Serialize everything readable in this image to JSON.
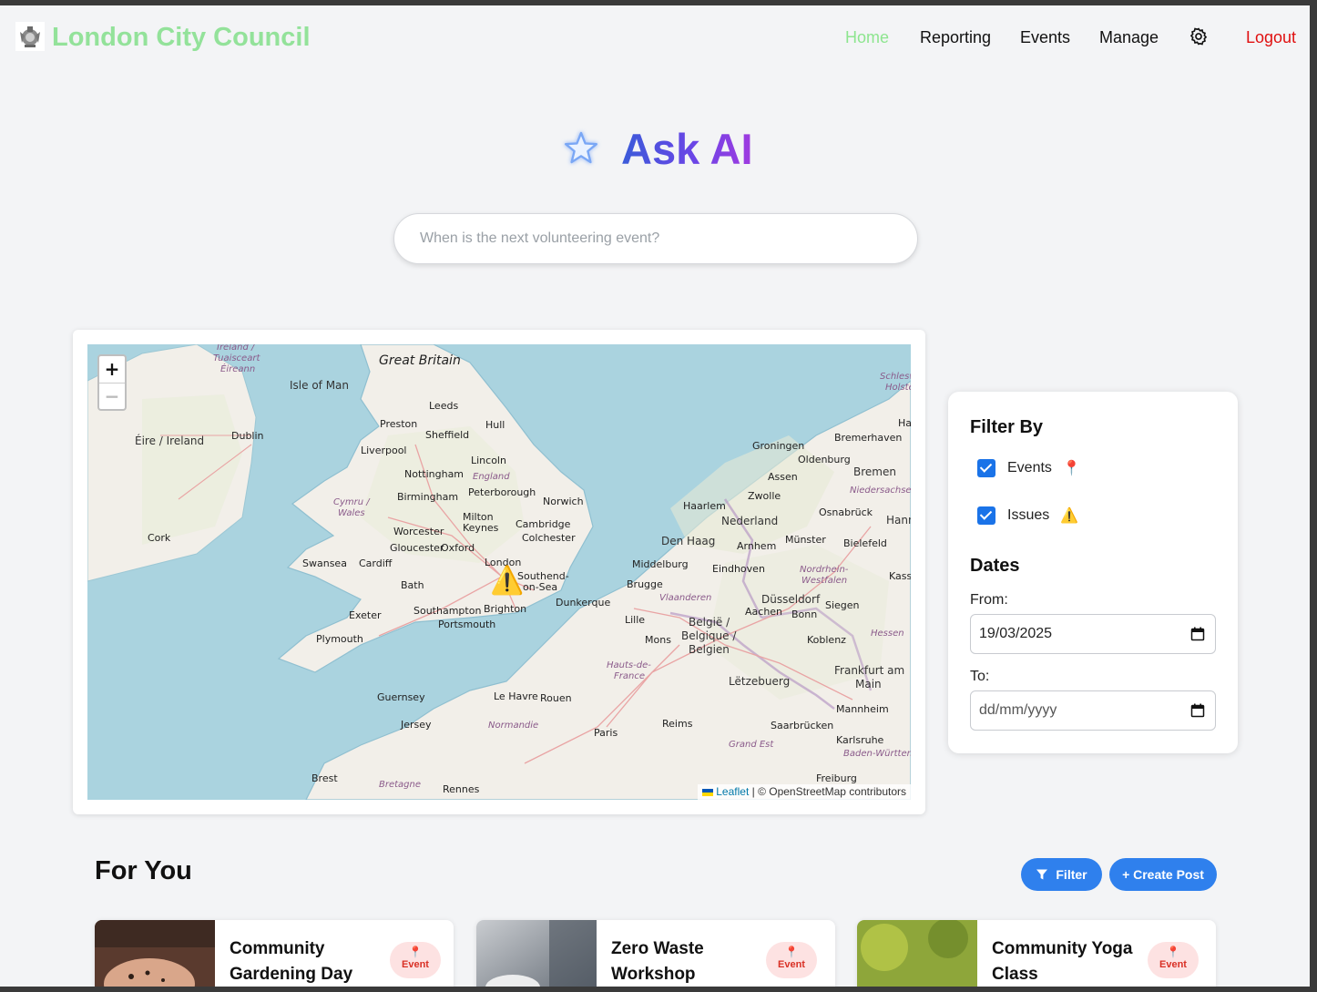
{
  "nav": {
    "brand": "London City Council",
    "links": {
      "home": "Home",
      "reporting": "Reporting",
      "events": "Events",
      "manage": "Manage"
    },
    "logout": "Logout"
  },
  "hero": {
    "title": "Ask AI",
    "search_placeholder": "When is the next volunteering event?"
  },
  "map": {
    "zoom_in": "+",
    "zoom_out": "−",
    "attribution_leaflet": "Leaflet",
    "attribution_rest": "| © OpenStreetMap contributors",
    "places": {
      "great_britain": "Great Britain",
      "ireland_ga": "Ireland /",
      "ireland_tuaisceart": "Tuaisceart",
      "ireland_eireann": "Éireann",
      "isle_of_man": "Isle of Man",
      "eire": "Éire / Ireland",
      "dublin": "Dublin",
      "cork": "Cork",
      "leeds": "Leeds",
      "preston": "Preston",
      "hull": "Hull",
      "sheffield": "Sheffield",
      "liverpool": "Liverpool",
      "lincoln": "Lincoln",
      "nottingham": "Nottingham",
      "england": "England",
      "birmingham": "Birmingham",
      "peterborough": "Peterborough",
      "norwich": "Norwich",
      "cymru": "Cymru /",
      "wales": "Wales",
      "milton_keynes_1": "Milton",
      "milton_keynes_2": "Keynes",
      "cambridge": "Cambridge",
      "worcester": "Worcester",
      "colchester": "Colchester",
      "gloucester": "Gloucester",
      "oxford": "Oxford",
      "london": "London",
      "swansea": "Swansea",
      "cardiff": "Cardiff",
      "southend_1": "Southend-",
      "southend_2": "on-Sea",
      "bath": "Bath",
      "southampton": "Southampton",
      "brighton": "Brighton",
      "exeter": "Exeter",
      "portsmouth": "Portsmouth",
      "plymouth": "Plymouth",
      "guernsey": "Guernsey",
      "jersey": "Jersey",
      "brest": "Brest",
      "bretagne": "Bretagne",
      "rennes": "Rennes",
      "normandie": "Normandie",
      "le_havre": "Le Havre",
      "rouen": "Rouen",
      "paris": "Paris",
      "reims": "Reims",
      "lille": "Lille",
      "dunkerque": "Dunkerque",
      "brugge": "Brugge",
      "middelburg": "Middelburg",
      "den_haag": "Den Haag",
      "haarlem": "Haarlem",
      "nederland": "Nederland",
      "groningen": "Groningen",
      "assen": "Assen",
      "zwolle": "Zwolle",
      "arnhem": "Arnhem",
      "eindhoven": "Eindhoven",
      "vlaanderen": "Vlaanderen",
      "belgie_1": "België /",
      "belgie_2": "Belgique /",
      "belgie_3": "Belgien",
      "mons": "Mons",
      "hauts_1": "Hauts-de-",
      "hauts_2": "France",
      "letzebuerg": "Lëtzebuerg",
      "grand_est": "Grand Est",
      "saarbrucken": "Saarbrücken",
      "karlsruhe": "Karlsruhe",
      "baden": "Baden-Württemb",
      "freiburg": "Freiburg",
      "frankfurt_1": "Frankfurt am",
      "frankfurt_2": "Main",
      "mannheim": "Mannheim",
      "hessen": "Hessen",
      "koblenz": "Koblenz",
      "bonn": "Bonn",
      "aachen": "Aachen",
      "dusseldorf": "Düsseldorf",
      "nrw_1": "Nordrhein-",
      "nrw_2": "Westfalen",
      "siegen": "Siegen",
      "kassel": "Kasse",
      "bielefeld": "Bielefeld",
      "munster": "Münster",
      "osnabruck": "Osnabrück",
      "niedersachsen": "Niedersachsen",
      "bremen": "Bremen",
      "oldenburg": "Oldenburg",
      "bremerhaven": "Bremerhaven",
      "hann": "Hann",
      "ha": "Ha",
      "schleswig_1": "Schlesw",
      "schleswig_2": "Holste"
    }
  },
  "filter": {
    "heading": "Filter By",
    "events_label": "Events",
    "issues_label": "Issues",
    "dates_heading": "Dates",
    "from_label": "From:",
    "from_value": "19/03/2025",
    "to_label": "To:",
    "to_placeholder": "dd/mm/yyyy"
  },
  "feed": {
    "heading": "For You",
    "filter_button": "Filter",
    "create_button": "+ Create Post",
    "posts": [
      {
        "title": "Community Gardening Day",
        "badge": "Event"
      },
      {
        "title": "Zero Waste Workshop",
        "badge": "Event"
      },
      {
        "title": "Community Yoga Class",
        "badge": "Event"
      }
    ]
  },
  "colors": {
    "brand_green": "#93e29a",
    "accent_blue": "#2f80ed",
    "logout_red": "#e01010"
  }
}
